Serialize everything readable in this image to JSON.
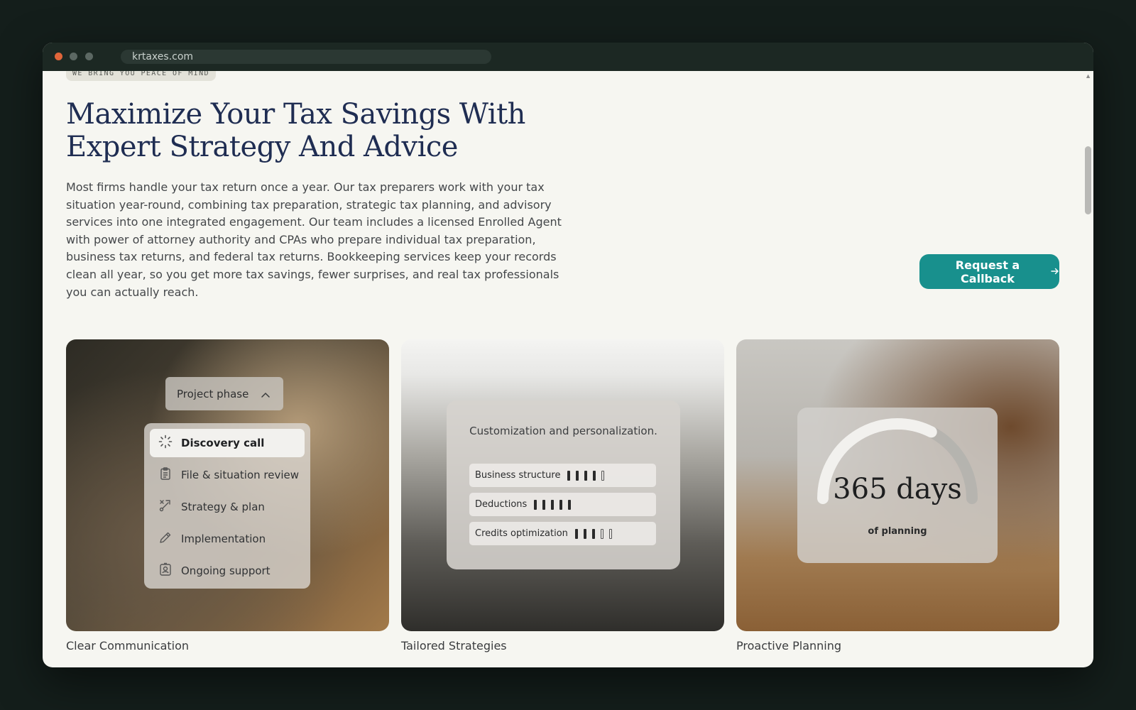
{
  "browser": {
    "url": "krtaxes.com"
  },
  "hero": {
    "eyebrow": "WE BRING YOU PEACE OF MIND",
    "title_line1": "Maximize Your Tax Savings With",
    "title_line2": "Expert Strategy And Advice",
    "description": "Most firms handle your tax return once a year. Our tax preparers work with your tax situation year-round, combining tax preparation, strategic tax planning, and advisory services into one integrated engagement. Our team includes a licensed Enrolled Agent with power of attorney authority and CPAs who prepare individual tax preparation, business tax returns, and federal tax returns. Bookkeeping services keep your records clean all year, so you get more tax savings, fewer surprises, and real tax professionals you can actually reach.",
    "cta_label": "Request a Callback",
    "cta_icon": "arrow-right-icon"
  },
  "cards": [
    {
      "caption": "Clear Communication",
      "phase_toggle_label": "Project phase",
      "phase_toggle_icon": "chevron-up-icon",
      "phases": [
        {
          "label": "Discovery call",
          "icon": "spinner-icon",
          "active": true
        },
        {
          "label": "File & situation review",
          "icon": "clipboard-icon",
          "active": false
        },
        {
          "label": "Strategy & plan",
          "icon": "route-icon",
          "active": false
        },
        {
          "label": "Implementation",
          "icon": "pencil-icon",
          "active": false
        },
        {
          "label": "Ongoing support",
          "icon": "support-icon",
          "active": false
        }
      ]
    },
    {
      "caption": "Tailored Strategies",
      "panel_title": "Customization and personalization.",
      "metrics": [
        {
          "label": "Business structure",
          "filled": 4,
          "total": 5
        },
        {
          "label": "Deductions",
          "filled": 5,
          "total": 5
        },
        {
          "label": "Credits optimization",
          "filled": 3,
          "total": 5
        }
      ]
    },
    {
      "caption": "Proactive Planning",
      "plan_value": "365 days",
      "plan_label": "of planning",
      "gauge_fraction": 0.65
    }
  ],
  "colors": {
    "accent": "#18908d",
    "title": "#1f2d52",
    "background": "#f6f6f1"
  }
}
